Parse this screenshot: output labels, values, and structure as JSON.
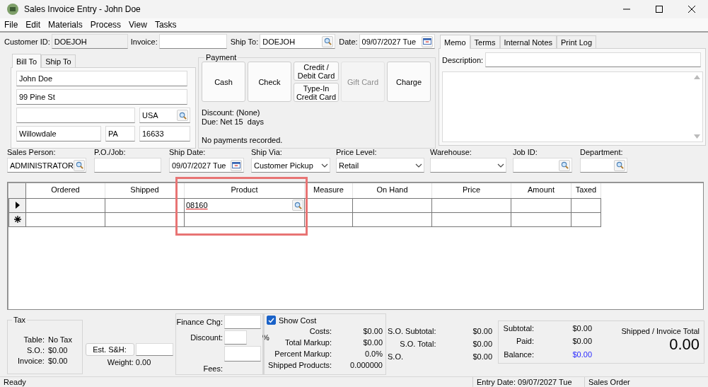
{
  "window": {
    "title": "Sales Invoice Entry - John Doe"
  },
  "menu": [
    "File",
    "Edit",
    "Materials",
    "Process",
    "View",
    "Tasks"
  ],
  "header_fields": [
    {
      "label": "Customer ID:",
      "value": "DOEJOH",
      "kind": "readonly"
    },
    {
      "label": "Invoice:",
      "kind": "text"
    },
    {
      "label": "Ship To:",
      "value": "DOEJOH",
      "kind": "lookup"
    },
    {
      "label": "Date:",
      "value": "09/07/2027 Tue",
      "kind": "date"
    }
  ],
  "address": {
    "tabs": [
      {
        "label": "Bill To",
        "selected": true
      },
      {
        "label": "Ship To",
        "selected": false
      }
    ],
    "fields": [
      {
        "value": "John Doe",
        "kind": "text"
      },
      {
        "value": "99 Pine St",
        "kind": "text"
      },
      {
        "kind": "text"
      },
      {
        "value": "USA",
        "kind": "lookup"
      },
      {
        "value": "Willowdale",
        "kind": "text"
      },
      {
        "value": "PA",
        "kind": "text"
      },
      {
        "value": "16633",
        "kind": "text"
      }
    ]
  },
  "payment": {
    "title": "Payment",
    "buttons": [
      {
        "kind": "single",
        "label": "Cash",
        "disabled": false
      },
      {
        "kind": "single",
        "label": "Check",
        "disabled": false
      },
      {
        "kind": "stack",
        "buttons": [
          {
            "label": "Credit /\nDebit Card",
            "disabled": false
          },
          {
            "label": "Type-In\nCredit Card",
            "disabled": false
          }
        ]
      },
      {
        "kind": "single",
        "label": "Gift Card",
        "disabled": true
      },
      {
        "kind": "single",
        "label": "Charge",
        "disabled": false
      }
    ],
    "discount": "Discount: (None)",
    "due": "Due: Net 15  days",
    "status": "No payments recorded."
  },
  "memo": {
    "tabs": [
      {
        "label": "Memo",
        "selected": true
      },
      {
        "label": "Terms",
        "selected": false
      },
      {
        "label": "Internal Notes",
        "selected": false
      },
      {
        "label": "Print Log",
        "selected": false
      }
    ],
    "description_label": "Description:"
  },
  "order_fields": [
    {
      "label": "Sales Person:",
      "value": "ADMINISTRATOR",
      "kind": "lookup"
    },
    {
      "label": "P.O./Job:",
      "kind": "text"
    },
    {
      "label": "Ship Date:",
      "value": "09/07/2027 Tue",
      "kind": "date"
    },
    {
      "label": "Ship Via:",
      "value": "Customer Pickup",
      "kind": "dropdown"
    },
    {
      "label": "Price Level:",
      "value": "Retail",
      "kind": "dropdown"
    },
    {
      "label": "Warehouse:",
      "kind": "dropdown"
    },
    {
      "label": "Job ID:",
      "kind": "lookup"
    },
    {
      "label": "Department:",
      "kind": "lookup"
    }
  ],
  "grid": {
    "columns": [
      {
        "label": "Ordered",
        "kind": "text"
      },
      {
        "label": "Shipped",
        "kind": "text"
      },
      {
        "label": "Product",
        "kind": "lookup"
      },
      {
        "label": "Measure",
        "kind": "text"
      },
      {
        "label": "On Hand",
        "kind": "text"
      },
      {
        "label": "Price",
        "kind": "text"
      },
      {
        "label": "Amount",
        "kind": "text"
      },
      {
        "label": "Taxed",
        "kind": "text"
      }
    ],
    "rows": [
      {
        "kind": "current",
        "editing": true,
        "cells": [
          "",
          "",
          "08160",
          "",
          "",
          "",
          "",
          ""
        ]
      },
      {
        "kind": "new",
        "editing": false,
        "cells": [
          "",
          "",
          "",
          "",
          "",
          "",
          "",
          ""
        ]
      }
    ]
  },
  "tax": {
    "title": "Tax",
    "rows": [
      {
        "label": "Table:",
        "value": "No Tax"
      },
      {
        "label": "S.O.:",
        "value": "$0.00"
      },
      {
        "label": "Invoice:",
        "value": "$0.00"
      }
    ]
  },
  "shipping": {
    "button": "Est. S&H:",
    "weight": "Weight: 0.00"
  },
  "charges": {
    "finance_label": "Finance Chg:",
    "discount_label": "Discount:",
    "percent": "%",
    "fees_label": "Fees:"
  },
  "cost": {
    "show_cost": {
      "label": "Show Cost",
      "checked": true
    },
    "rows": [
      {
        "label": "Costs:",
        "value": "$0.00"
      },
      {
        "label": "Total Markup:",
        "value": "$0.00"
      },
      {
        "label": "Percent Markup:",
        "value": "0.0%"
      },
      {
        "label": "Shipped Products:",
        "value": "0.000000"
      }
    ]
  },
  "so_totals": [
    {
      "label": "S.O. Subtotal:",
      "value": "$0.00"
    },
    {
      "label": "S.O. Total:",
      "value": "$0.00"
    },
    {
      "label": "S.O.",
      "value": "$0.00"
    }
  ],
  "totals": [
    {
      "label": "Subtotal:",
      "value": "$0.00",
      "highlighted": false
    },
    {
      "label": "Paid:",
      "value": "$0.00",
      "highlighted": false
    },
    {
      "label": "Balance:",
      "value": "$0.00",
      "highlighted": true
    }
  ],
  "grand_total": {
    "label": "Shipped / Invoice Total",
    "value": "0.00"
  },
  "status_bar": [
    "Ready",
    "Entry Date: 09/07/2027 Tue",
    "Sales Order"
  ]
}
